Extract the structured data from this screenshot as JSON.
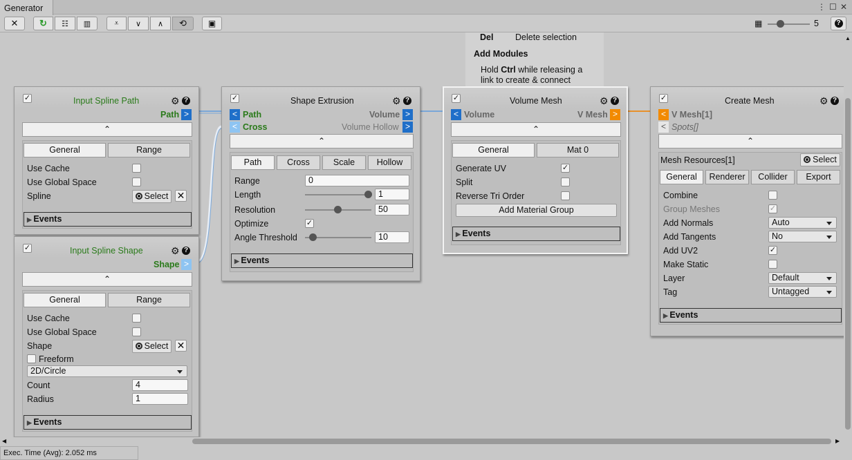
{
  "window": {
    "title": "Generator"
  },
  "toolbar": {
    "zoom_value": "5"
  },
  "help": {
    "del_key": "Del",
    "del_desc": "Delete selection",
    "add_modules": "Add Modules",
    "hint_pre": "Hold ",
    "hint_key": "Ctrl",
    "hint_post": " while releasing a",
    "hint2": "link to create & connect"
  },
  "n1": {
    "title": "Input Spline Path",
    "out": "Path",
    "tab1": "General",
    "tab2": "Range",
    "r1": "Use Cache",
    "r2": "Use Global Space",
    "r3": "Spline",
    "select": "Select",
    "events": "Events"
  },
  "n2": {
    "title": "Input Spline Shape",
    "out": "Shape",
    "tab1": "General",
    "tab2": "Range",
    "r1": "Use Cache",
    "r2": "Use Global Space",
    "r3": "Shape",
    "select": "Select",
    "freeform": "Freeform",
    "preset": "2D/Circle",
    "count_label": "Count",
    "count": "4",
    "radius_label": "Radius",
    "radius": "1",
    "events": "Events"
  },
  "n3": {
    "title": "Shape Extrusion",
    "in1": "Path",
    "in2": "Cross",
    "out1": "Volume",
    "out2": "Volume Hollow",
    "tabs": [
      "Path",
      "Cross",
      "Scale",
      "Hollow"
    ],
    "range_label": "Range",
    "range": "0",
    "length_label": "Length",
    "length": "1",
    "res_label": "Resolution",
    "res": "50",
    "opt_label": "Optimize",
    "angle_label": "Angle Threshold",
    "angle": "10",
    "events": "Events"
  },
  "n4": {
    "title": "Volume Mesh",
    "in1": "Volume",
    "out1": "V Mesh",
    "tab1": "General",
    "tab2": "Mat 0",
    "r1": "Generate UV",
    "r2": "Split",
    "r3": "Reverse Tri Order",
    "add_mat": "Add Material Group",
    "events": "Events"
  },
  "n5": {
    "title": "Create Mesh",
    "in1": "V Mesh[1]",
    "in2": "Spots[]",
    "res_label": "Mesh Resources[1]",
    "select": "Select",
    "tabs": [
      "General",
      "Renderer",
      "Collider",
      "Export"
    ],
    "r1": "Combine",
    "r2": "Group Meshes",
    "r3": "Add Normals",
    "normals": "Auto",
    "r4": "Add Tangents",
    "tangents": "No",
    "r5": "Add UV2",
    "r6": "Make Static",
    "r7": "Layer",
    "layer": "Default",
    "r8": "Tag",
    "tag": "Untagged",
    "events": "Events"
  },
  "status": {
    "text": "Exec. Time (Avg): 2.052 ms"
  },
  "colors": {
    "port_blue": "#1f6fc9",
    "port_orange": "#f28a00",
    "label_green": "#2a7a1a",
    "link_blue": "#7aa7d8",
    "link_orange": "#e8902a"
  }
}
